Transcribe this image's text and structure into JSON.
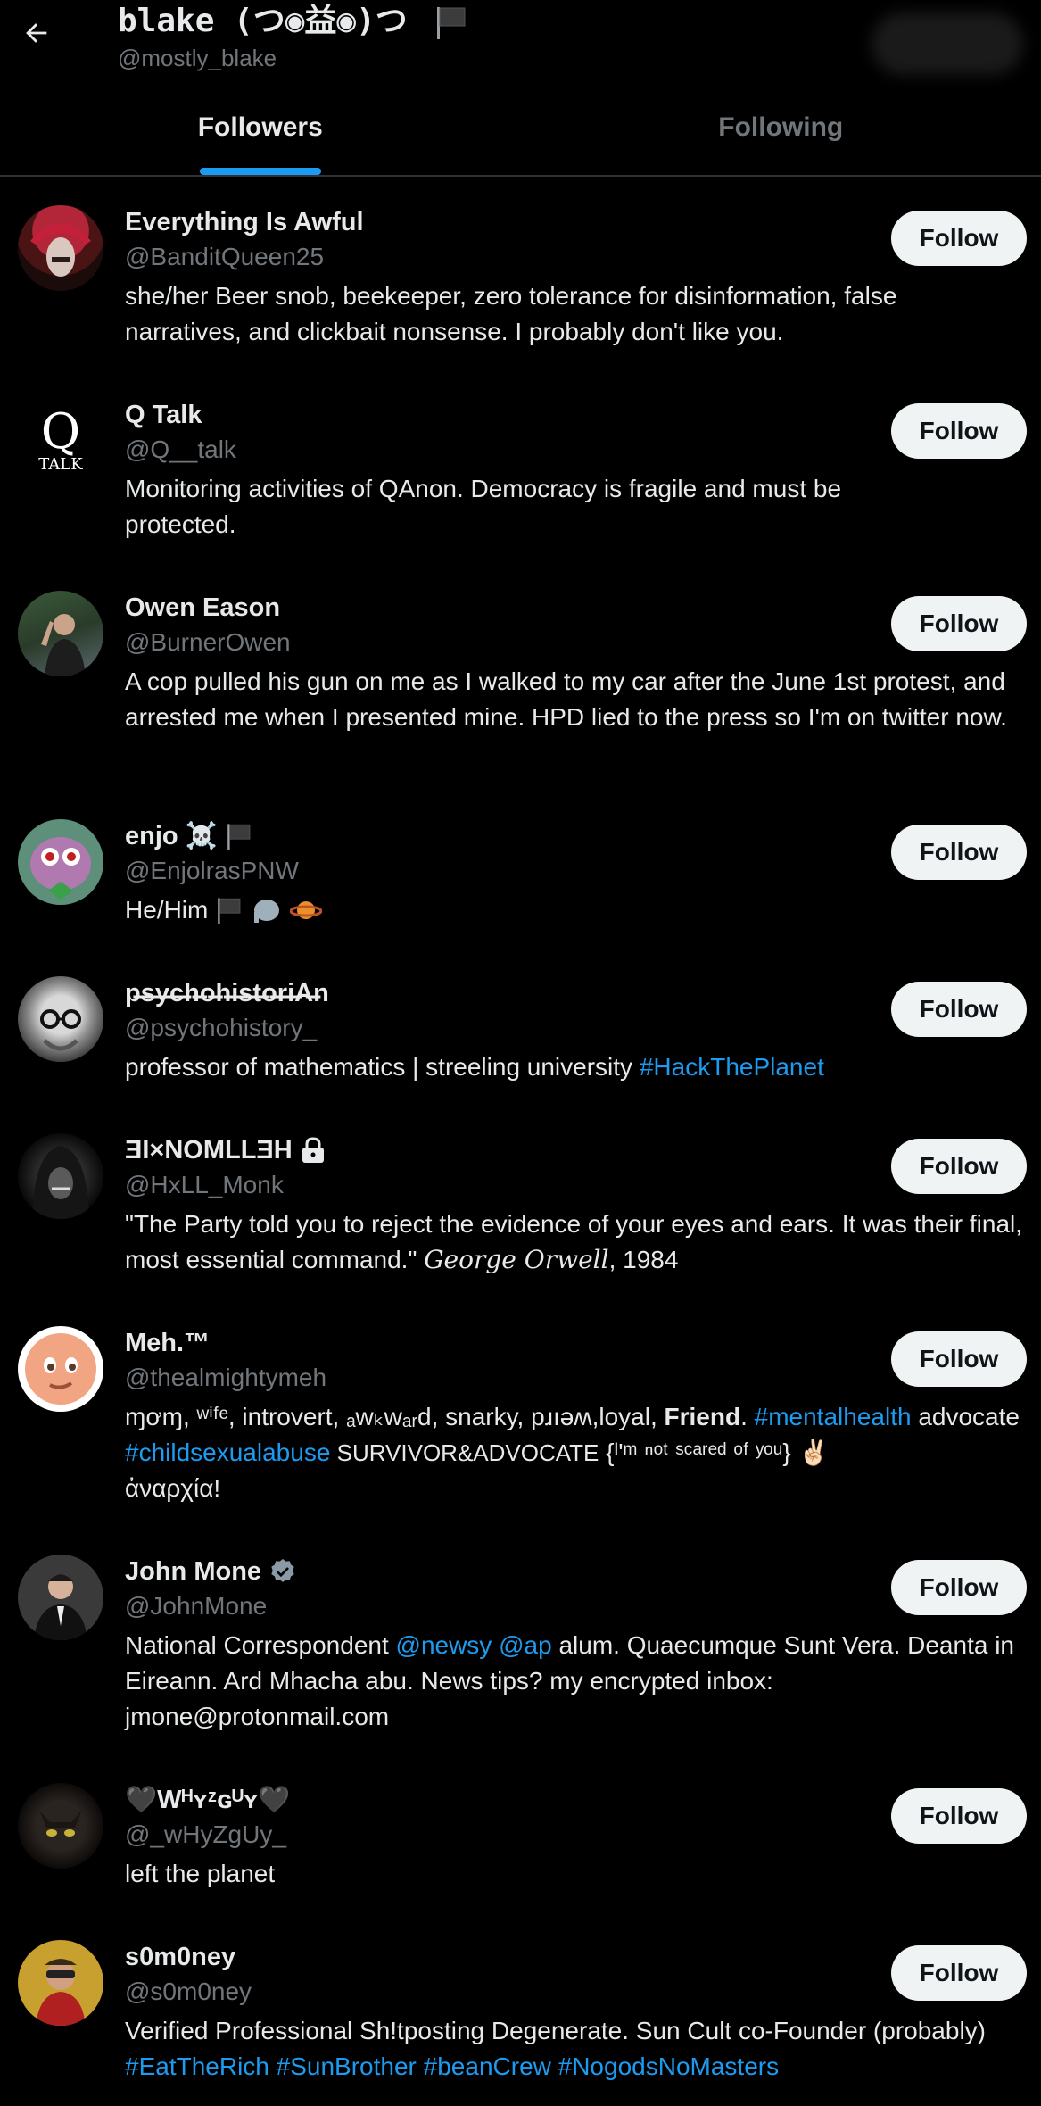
{
  "header": {
    "back_icon": "arrow-left-icon",
    "profile_name": "blake (つ◉益◉)つ",
    "profile_handle": "@mostly_blake"
  },
  "tabs": [
    {
      "label": "Followers",
      "active": true
    },
    {
      "label": "Following",
      "active": false
    }
  ],
  "follow_label": "Follow",
  "users": [
    {
      "name": "Everything Is Awful",
      "handle": "@BanditQueen25",
      "bio": "she/her Beer snob, beekeeper, zero tolerance for disinformation, false narratives, and clickbait nonsense. I probably don't like you."
    },
    {
      "name": "Q Talk",
      "handle": "@Q__talk",
      "bio": "Monitoring activities of QAnon. Democracy is fragile and must be protected.",
      "avatar_text_big": "Q",
      "avatar_text_small": "TALK"
    },
    {
      "name": "Owen Eason",
      "handle": "@BurnerOwen",
      "bio": "A cop pulled his gun on me as I walked to my car after the June 1st protest, and arrested me when I presented mine. HPD lied to the press so I'm on twitter now."
    },
    {
      "name": "enjo ☠️",
      "handle": "@EnjolrasPNW",
      "bio": "He/Him"
    },
    {
      "name": "p̶s̶y̶c̶h̶o̶h̶i̶s̶t̶o̶r̶i̶A̶n",
      "handle": "@psychohistory_",
      "bio_text": "professor of mathematics | streeling university ",
      "bio_link": "#HackThePlanet"
    },
    {
      "name": "ƎI×NOMLLƎH",
      "handle": "@HxLL_Monk",
      "bio_text": "\"The Party told you to reject the evidence of your eyes and ears. It was their final, most essential command.\" ",
      "bio_cursive": "George Orwell",
      "bio_tail": ", 1984"
    },
    {
      "name": "Meh.™",
      "handle": "@thealmightymeh",
      "bio_part1": "ɱơɱ, ʷⁱᶠᵉ, introvert, ₐwₖwₐᵣd, snarky, pɹıəʍ,loyal, ",
      "bio_bold": "Friend",
      "bio_part2": ". ",
      "bio_link1": "#mentalhealth",
      "bio_part3": " advocate ",
      "bio_link2": "#childsexualabuse",
      "bio_part4": " SURVIVOR&ADVOCATE",
      "bio_part5": " {ᴵ'ᵐ ⁿᵒᵗ ˢᶜᵃʳᵉᵈ ᵒᶠ ʸᵒᵘ} ✌🏻",
      "bio_part6": "ἀναρχία!"
    },
    {
      "name": "John Mone",
      "handle": "@JohnMone",
      "bio_part1": "National Correspondent ",
      "bio_link1": "@newsy",
      "bio_part2": " ",
      "bio_link2": "@ap",
      "bio_part3": " alum. Quaecumque Sunt Vera. Deanta in Eireann. Ard Mhacha abu. News tips? my encrypted inbox: jmone@protonmail.com"
    },
    {
      "name": "🖤Wᴴʏᶻɢᵁʏ🖤",
      "handle": "@_wHyZgUy_",
      "bio": "left the planet"
    },
    {
      "name": "s0m0ney",
      "handle": "@s0m0ney",
      "bio_text": "Verified Professional Sh!tposting Degenerate. Sun Cult co-Founder (probably) ",
      "bio_link1": "#EatTheRich",
      "bio_link2": "#SunBrother",
      "bio_link3": "#beanCrew",
      "bio_link4": "#NogodsNoMasters"
    }
  ]
}
